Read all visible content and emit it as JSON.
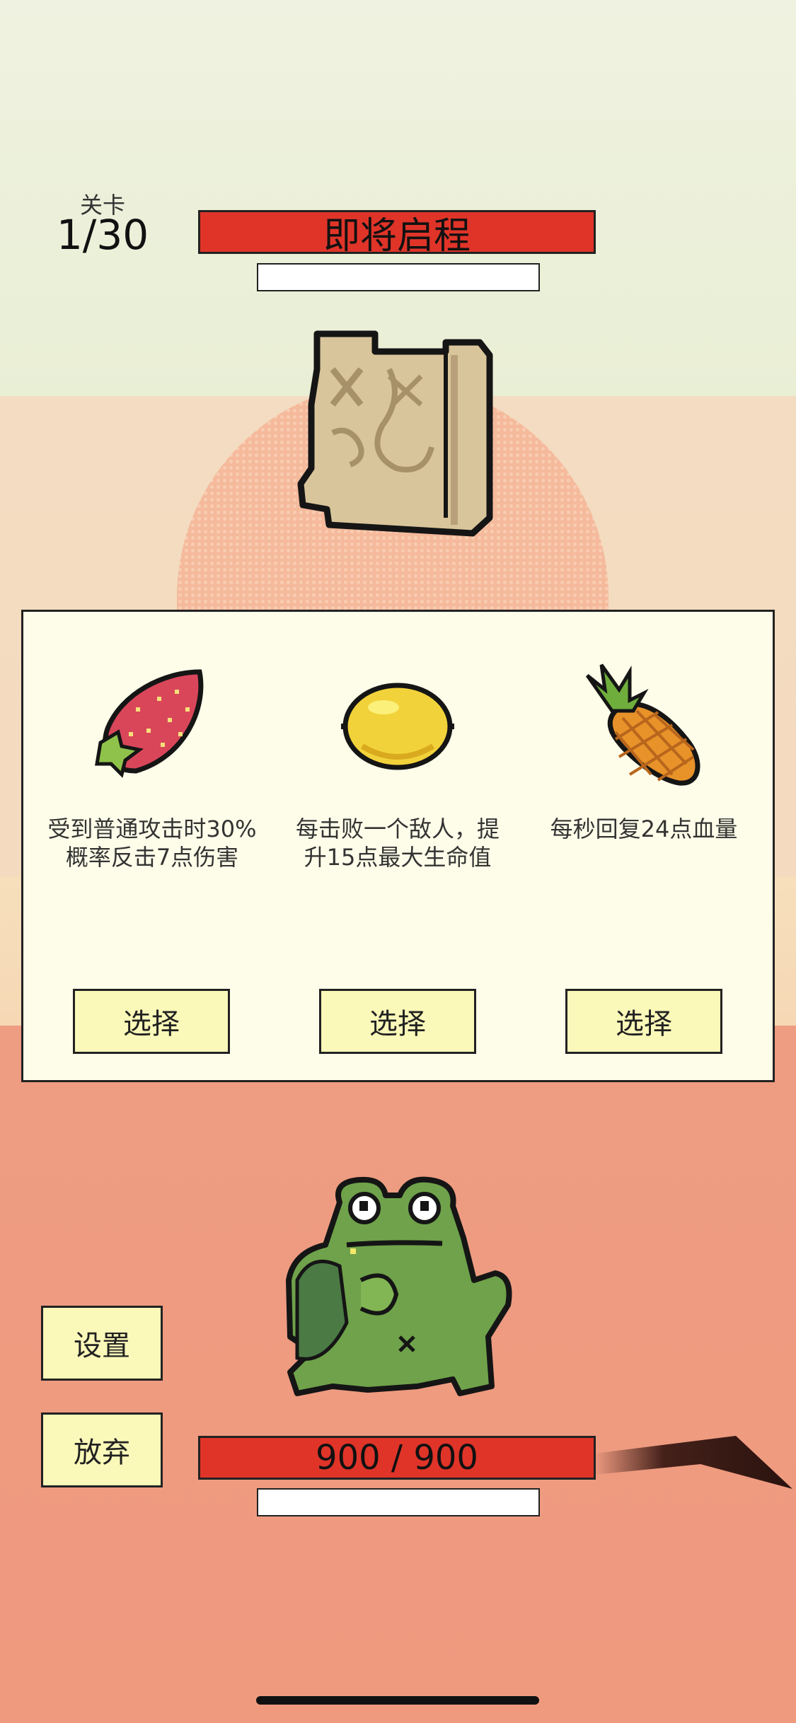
{
  "hud": {
    "stage_label": "关卡",
    "stage_value": "1/30",
    "title": "即将启程"
  },
  "reward_panel": {
    "items": [
      {
        "icon": "strawberry-icon",
        "description": "受到普通攻击时30%概率反击7点伤害",
        "select_label": "选择"
      },
      {
        "icon": "lemon-icon",
        "description": "每击败一个敌人，提升15点最大生命值",
        "select_label": "选择"
      },
      {
        "icon": "pineapple-icon",
        "description": "每秒回复24点血量",
        "select_label": "选择"
      }
    ]
  },
  "side_menu": {
    "settings_label": "设置",
    "give_up_label": "放弃"
  },
  "player": {
    "hp_text": "900 / 900",
    "hp_fraction": 1.0
  },
  "colors": {
    "health_red": "#e03429",
    "panel_bg": "#fefde9",
    "button_bg": "#fbf9b9"
  }
}
